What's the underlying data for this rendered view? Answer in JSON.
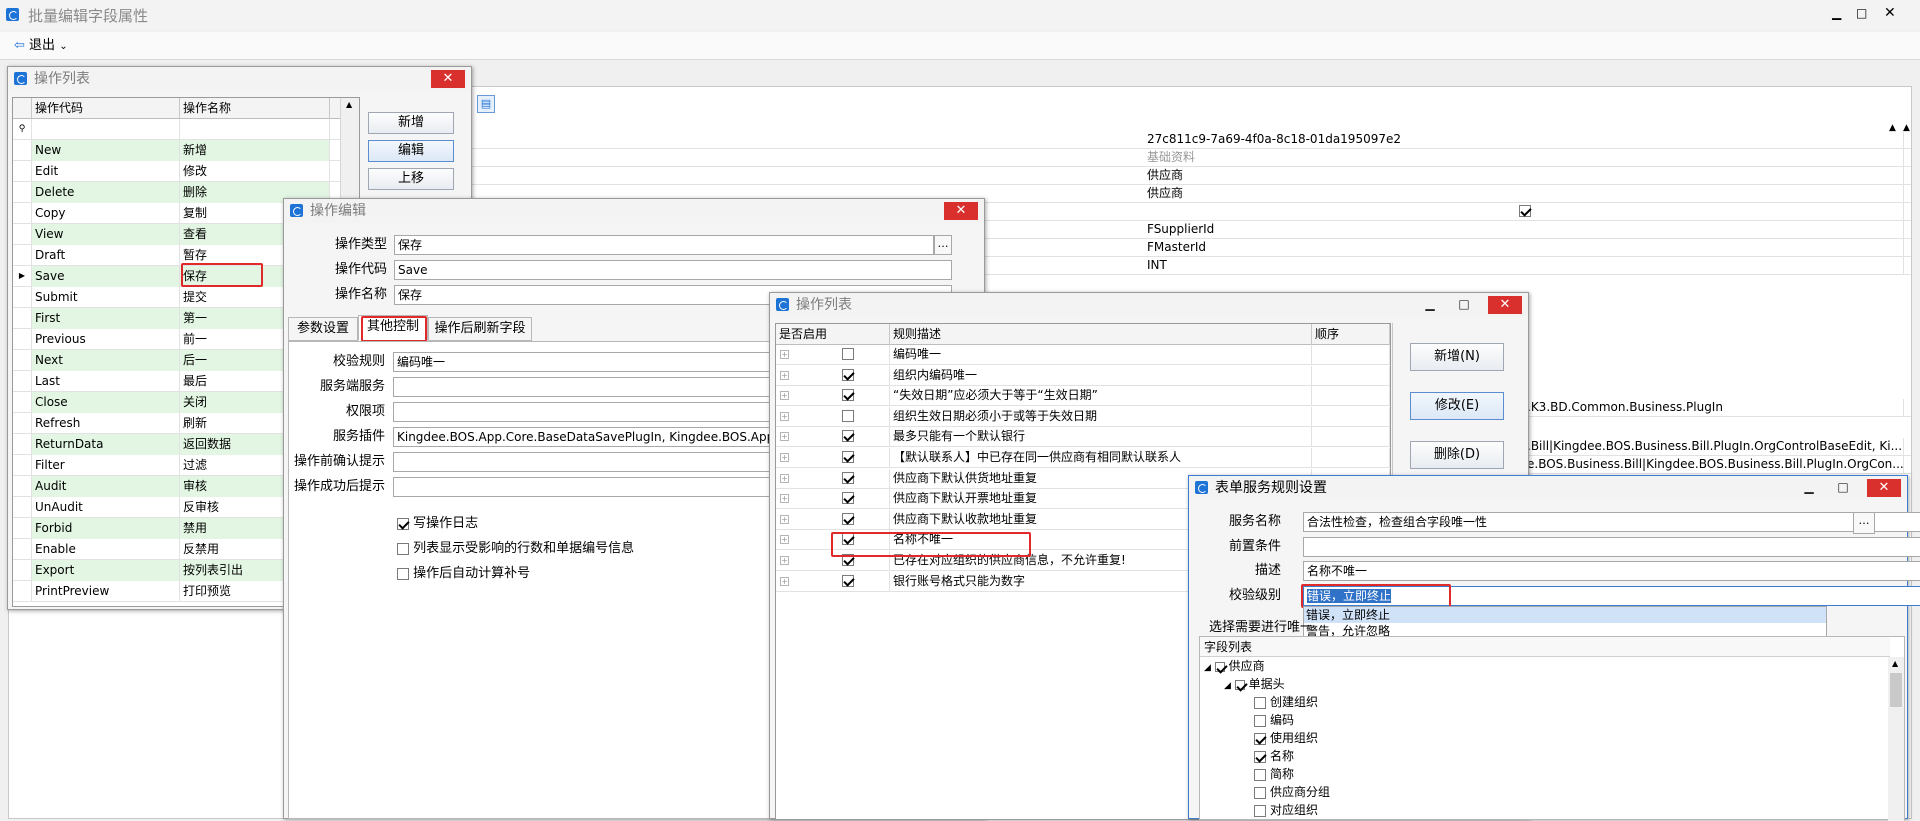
{
  "main": {
    "title": "批量编辑字段属性",
    "exit_label": "退出",
    "props": [
      "27c811c9-7a69-4f0a-8c18-01da195097e2",
      "基础资料",
      "供应商",
      "供应商",
      "",
      "FSupplierId",
      "FMasterId",
      "INT"
    ],
    "plugin_rows": [
      ".K3.BD.Common.Business.PlugIn",
      ".Bill|Kingdee.BOS.Business.Bill.PlugIn.OrgControlBaseEdit, Ki...",
      "e.BOS.Business.Bill|Kingdee.BOS.Business.Bill.PlugIn.OrgCon..."
    ]
  },
  "oplist": {
    "title": "操作列表",
    "col_code": "操作代码",
    "col_name": "操作名称",
    "buttons": {
      "add": "新增",
      "edit": "编辑",
      "up": "上移"
    },
    "rows": [
      {
        "code": "New",
        "name": "新增"
      },
      {
        "code": "Edit",
        "name": "修改"
      },
      {
        "code": "Delete",
        "name": "删除"
      },
      {
        "code": "Copy",
        "name": "复制"
      },
      {
        "code": "View",
        "name": "查看"
      },
      {
        "code": "Draft",
        "name": "暂存"
      },
      {
        "code": "Save",
        "name": "保存"
      },
      {
        "code": "Submit",
        "name": "提交"
      },
      {
        "code": "First",
        "name": "第一"
      },
      {
        "code": "Previous",
        "name": "前一"
      },
      {
        "code": "Next",
        "name": "后一"
      },
      {
        "code": "Last",
        "name": "最后"
      },
      {
        "code": "Close",
        "name": "关闭"
      },
      {
        "code": "Refresh",
        "name": "刷新"
      },
      {
        "code": "ReturnData",
        "name": "返回数据"
      },
      {
        "code": "Filter",
        "name": "过滤"
      },
      {
        "code": "Audit",
        "name": "审核"
      },
      {
        "code": "UnAudit",
        "name": "反审核"
      },
      {
        "code": "Forbid",
        "name": "禁用"
      },
      {
        "code": "Enable",
        "name": "反禁用"
      },
      {
        "code": "Export",
        "name": "按列表引出"
      },
      {
        "code": "PrintPreview",
        "name": "打印预览"
      }
    ]
  },
  "opedit": {
    "title": "操作编辑",
    "type_label": "操作类型",
    "type_value": "保存",
    "code_label": "操作代码",
    "code_value": "Save",
    "name_label": "操作名称",
    "name_value": "保存",
    "tabs": [
      "参数设置",
      "其他控制",
      "操作后刷新字段"
    ],
    "rule_label": "校验规则",
    "rule_value": "编码唯一",
    "service_label": "服务端服务",
    "perm_label": "权限项",
    "plugin_label": "服务插件",
    "plugin_value": "Kingdee.BOS.App.Core.BaseDataSavePlugIn, Kingdee.BOS.App.Core",
    "confirm_label": "操作前确认提示",
    "success_label": "操作成功后提示",
    "cb_log": "写操作日志",
    "cb_list": "列表显示受影响的行数和单据编号信息",
    "cb_auto": "操作后自动计算补号"
  },
  "rules": {
    "title": "操作列表",
    "col_enabled": "是否启用",
    "col_desc": "规则描述",
    "col_order": "顺序",
    "buttons": {
      "add": "新增(N)",
      "edit": "修改(E)",
      "delete": "删除(D)"
    },
    "rows": [
      {
        "on": false,
        "desc": "编码唯一"
      },
      {
        "on": true,
        "desc": "组织内编码唯一"
      },
      {
        "on": true,
        "desc": "“失效日期”应必须大于等于“生效日期”"
      },
      {
        "on": false,
        "desc": "组织生效日期必须小于或等于失效日期"
      },
      {
        "on": true,
        "desc": "最多只能有一个默认银行"
      },
      {
        "on": true,
        "desc": "【默认联系人】中已存在同一供应商有相同默认联系人"
      },
      {
        "on": true,
        "desc": "供应商下默认供货地址重复"
      },
      {
        "on": true,
        "desc": "供应商下默认开票地址重复"
      },
      {
        "on": true,
        "desc": "供应商下默认收款地址重复"
      },
      {
        "on": true,
        "desc": "名称不唯一"
      },
      {
        "on": true,
        "desc": "已存在对应组织的供应商信息，不允许重复!"
      },
      {
        "on": true,
        "desc": "银行账号格式只能为数字"
      }
    ]
  },
  "svc": {
    "title": "表单服务规则设置",
    "name_label": "服务名称",
    "name_value": "合法性检查，检查组合字段唯一性",
    "pre_label": "前置条件",
    "desc_label": "描述",
    "desc_value": "名称不唯一",
    "level_label": "校验级别",
    "level_value": "错误，立即终止",
    "options": [
      "错误，立即终止",
      "警告，允许忽略"
    ],
    "select_label": "选择需要进行唯一",
    "field_list": "字段列表",
    "tree": {
      "root": "供应商",
      "head": "单据头",
      "fields": [
        {
          "on": false,
          "name": "创建组织"
        },
        {
          "on": false,
          "name": "编码"
        },
        {
          "on": true,
          "name": "使用组织"
        },
        {
          "on": true,
          "name": "名称"
        },
        {
          "on": false,
          "name": "简称"
        },
        {
          "on": false,
          "name": "供应商分组"
        },
        {
          "on": false,
          "name": "对应组织"
        }
      ]
    }
  }
}
